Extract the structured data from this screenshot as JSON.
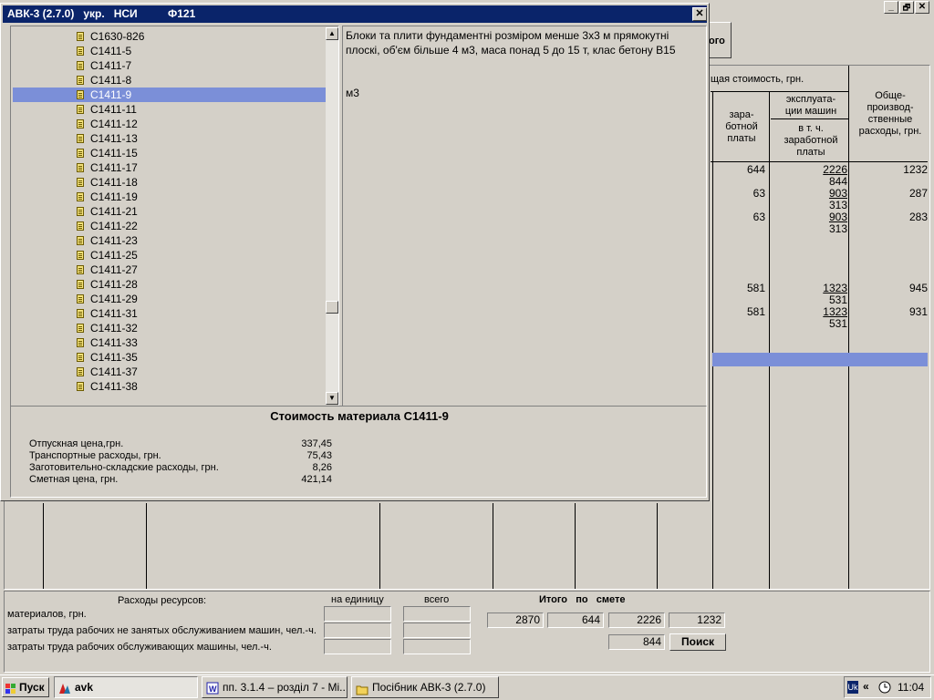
{
  "main": {
    "title": "",
    "win_buttons": {
      "min": "_",
      "max": "🗗",
      "close": "✕"
    },
    "top_button": "ого",
    "table_headers": {
      "total_cost": "щая стоимость, грн.",
      "wages": "зара-\nботной\nплаты",
      "machines": "эксплуата-\nции машин",
      "machines_wages": "в т. ч.\nзаработной\nплаты",
      "overhead": "Обще-\nпроизвод-\nственные\nрасходы, грн."
    },
    "rows": [
      {
        "wages": "644",
        "machines": "2226",
        "machines_wages": "844",
        "overhead": "1232"
      },
      {
        "wages": "63",
        "machines": "903",
        "machines_wages": "313",
        "overhead": "287"
      },
      {
        "wages": "63",
        "machines": "903",
        "machines_wages": "313",
        "overhead": "283"
      },
      {
        "wages": "581",
        "machines": "1323",
        "machines_wages": "531",
        "overhead": "945"
      },
      {
        "wages": "581",
        "machines": "1323",
        "machines_wages": "531",
        "overhead": "931"
      }
    ]
  },
  "resources": {
    "title": "Расходы ресурсов:",
    "per_unit": "на единицу",
    "total": "всего",
    "materials": "материалов, грн.",
    "labor_not_machines": "затраты труда рабочих не занятых обслуживанием машин, чел.-ч.",
    "labor_machines": "затраты труда рабочих обслуживающих машины, чел.-ч."
  },
  "totals": {
    "title": "Итого   по   смете",
    "v1": "2870",
    "v2": "644",
    "v3": "2226",
    "v4": "1232",
    "v5": "844",
    "search_button": "Поиск"
  },
  "dialog": {
    "title": "АВК-3 (2.7.0)   укр.   НСИ          Ф121",
    "close": "✕",
    "tree_items": [
      "С1630-826",
      "С1411-5",
      "С1411-7",
      "С1411-8",
      "С1411-9",
      "С1411-11",
      "С1411-12",
      "С1411-13",
      "С1411-15",
      "С1411-17",
      "С1411-18",
      "С1411-19",
      "С1411-21",
      "С1411-22",
      "С1411-23",
      "С1411-25",
      "С1411-27",
      "С1411-28",
      "С1411-29",
      "С1411-31",
      "С1411-32",
      "С1411-33",
      "С1411-35",
      "С1411-37",
      "С1411-38"
    ],
    "selected_index": 4,
    "description": "Блоки та плити фундаментні розміром менше 3х3 м прямокутні плоскі, об'єм більше 4 м3, маса понад 5 до 15 т, клас бетону B15",
    "unit": "м3",
    "cost_title": "Стоимость материала С1411-9",
    "costs": [
      {
        "label": "Отпускная цена,грн.",
        "value": "337,45"
      },
      {
        "label": "Транспортные расходы, грн.",
        "value": "75,43"
      },
      {
        "label": "Заготовительно-складские расходы, грн.",
        "value": "8,26"
      },
      {
        "label": "Сметная цена, грн.",
        "value": "421,14"
      }
    ]
  },
  "taskbar": {
    "start": "Пуск",
    "items": [
      "avk",
      "пп. 3.1.4 – розділ 7 - Mi...",
      "Посібник АВК-3 (2.7.0)"
    ],
    "lang": "Uk",
    "time": "11:04"
  }
}
